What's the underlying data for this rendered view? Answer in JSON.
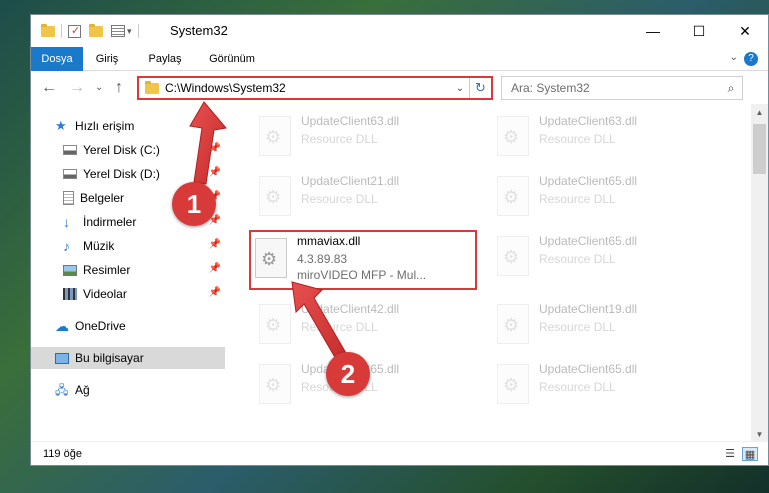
{
  "window": {
    "title": "System32",
    "controls": {
      "minimize": "—",
      "maximize": "☐",
      "close": "✕"
    }
  },
  "ribbon": {
    "tabs": [
      "Dosya",
      "Giriş",
      "Paylaş",
      "Görünüm"
    ],
    "help": "?"
  },
  "nav": {
    "back": "←",
    "forward": "→",
    "recent": "⌄",
    "up": "↑",
    "address": "C:\\Windows\\System32",
    "address_dropdown": "⌄",
    "refresh": "↻",
    "search_placeholder": "Ara: System32",
    "search_icon": "⌕"
  },
  "sidebar": {
    "items": [
      {
        "label": "Hızlı erişim",
        "icon": "star-icon"
      },
      {
        "label": "Yerel Disk (C:)",
        "icon": "drive-icon",
        "pin": "📌"
      },
      {
        "label": "Yerel Disk (D:)",
        "icon": "drive-icon",
        "pin": "📌"
      },
      {
        "label": "Belgeler",
        "icon": "document-icon",
        "pin": "📌"
      },
      {
        "label": "İndirmeler",
        "icon": "download-icon",
        "pin": "📌"
      },
      {
        "label": "Müzik",
        "icon": "music-icon",
        "pin": "📌"
      },
      {
        "label": "Resimler",
        "icon": "picture-icon",
        "pin": "📌"
      },
      {
        "label": "Videolar",
        "icon": "video-icon",
        "pin": "📌"
      },
      {
        "label": "OneDrive",
        "icon": "cloud-icon"
      },
      {
        "label": "Bu bilgisayar",
        "icon": "computer-icon"
      },
      {
        "label": "Ağ",
        "icon": "network-icon"
      }
    ]
  },
  "files": [
    {
      "name": "UpdateClient63.dll",
      "desc": "Resource DLL"
    },
    {
      "name": "UpdateClient63.dll",
      "desc": "Resource DLL"
    },
    {
      "name": "UpdateClient21.dll",
      "desc": "Resource DLL"
    },
    {
      "name": "UpdateClient65.dll",
      "desc": "Resource DLL"
    },
    {
      "name": "mmaviax.dll",
      "version": "4.3.89.83",
      "desc": "miroVIDEO MFP - Mul..."
    },
    {
      "name": "UpdateClient65.dll",
      "desc": "Resource DLL"
    },
    {
      "name": "UpdateClient42.dll",
      "desc": "Resource DLL"
    },
    {
      "name": "UpdateClient19.dll",
      "desc": "Resource DLL"
    },
    {
      "name": "UpdateClient65.dll",
      "desc": "Resource DLL"
    },
    {
      "name": "UpdateClient65.dll",
      "desc": "Resource DLL"
    }
  ],
  "status": {
    "count": "119 öğe"
  },
  "callouts": {
    "one": "1",
    "two": "2"
  },
  "colors": {
    "accent": "#1979ca",
    "callout": "#d83a3a"
  }
}
